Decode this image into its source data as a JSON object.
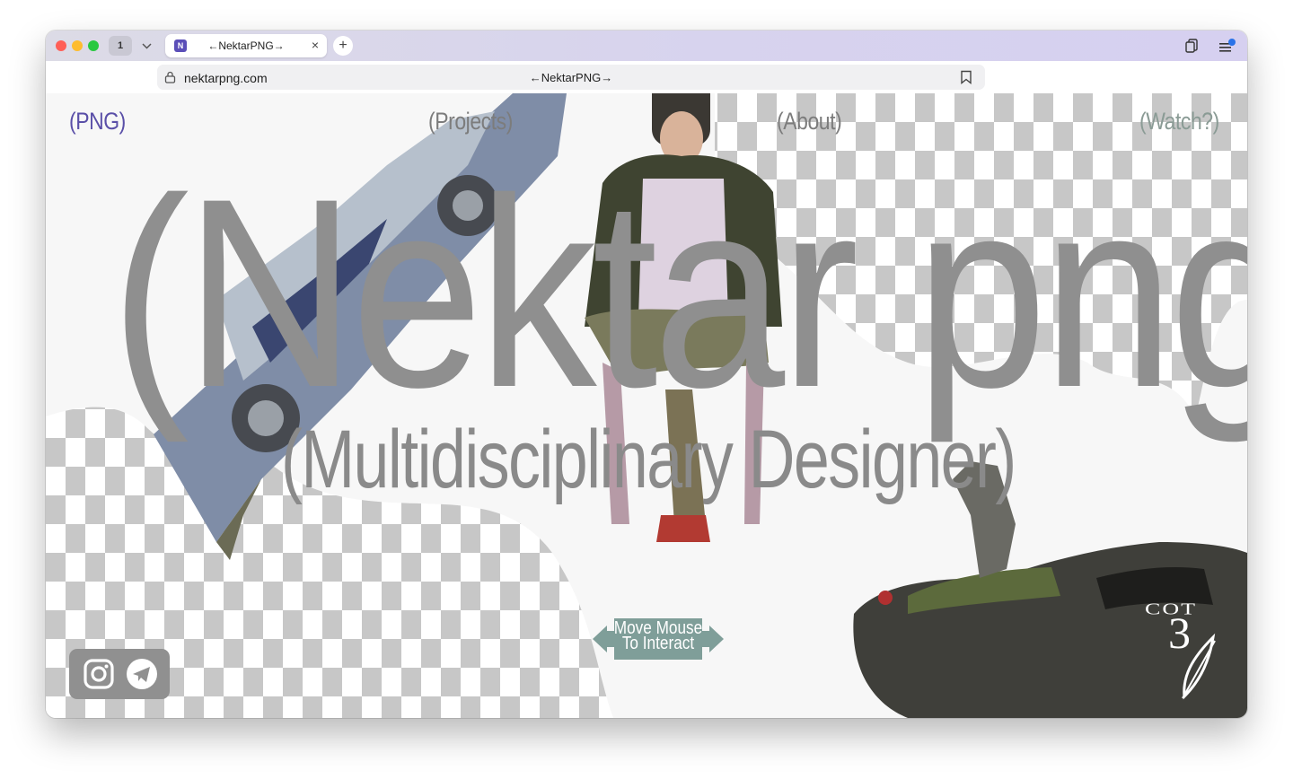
{
  "browser": {
    "tab_count": "1",
    "tab_title": "←NektarPNG→",
    "favicon_letter": "N",
    "url_domain": "nektarpng.com",
    "page_title": "←NektarPNG→"
  },
  "nav": {
    "home": "(PNG)",
    "projects": "(Projects)",
    "about": "(About)",
    "watch": "(Watch?)"
  },
  "hero": {
    "title": "(Nektar png)",
    "subtitle": "(Multidisciplinary Designer)"
  },
  "hint": {
    "line1": "Move Mouse",
    "line2": "To Interact"
  },
  "social": {
    "instagram": "instagram-icon",
    "telegram": "telegram-icon"
  },
  "logo": {
    "text_top": "COT",
    "numeral": "3"
  },
  "colors": {
    "nav_home": "#5a4fa8",
    "nav_other": "#7c7c7c",
    "nav_watch": "#8a9b95",
    "hero_text": "#8f8f8f",
    "hint_badge": "#7f9e99",
    "social_badge": "#909090"
  }
}
